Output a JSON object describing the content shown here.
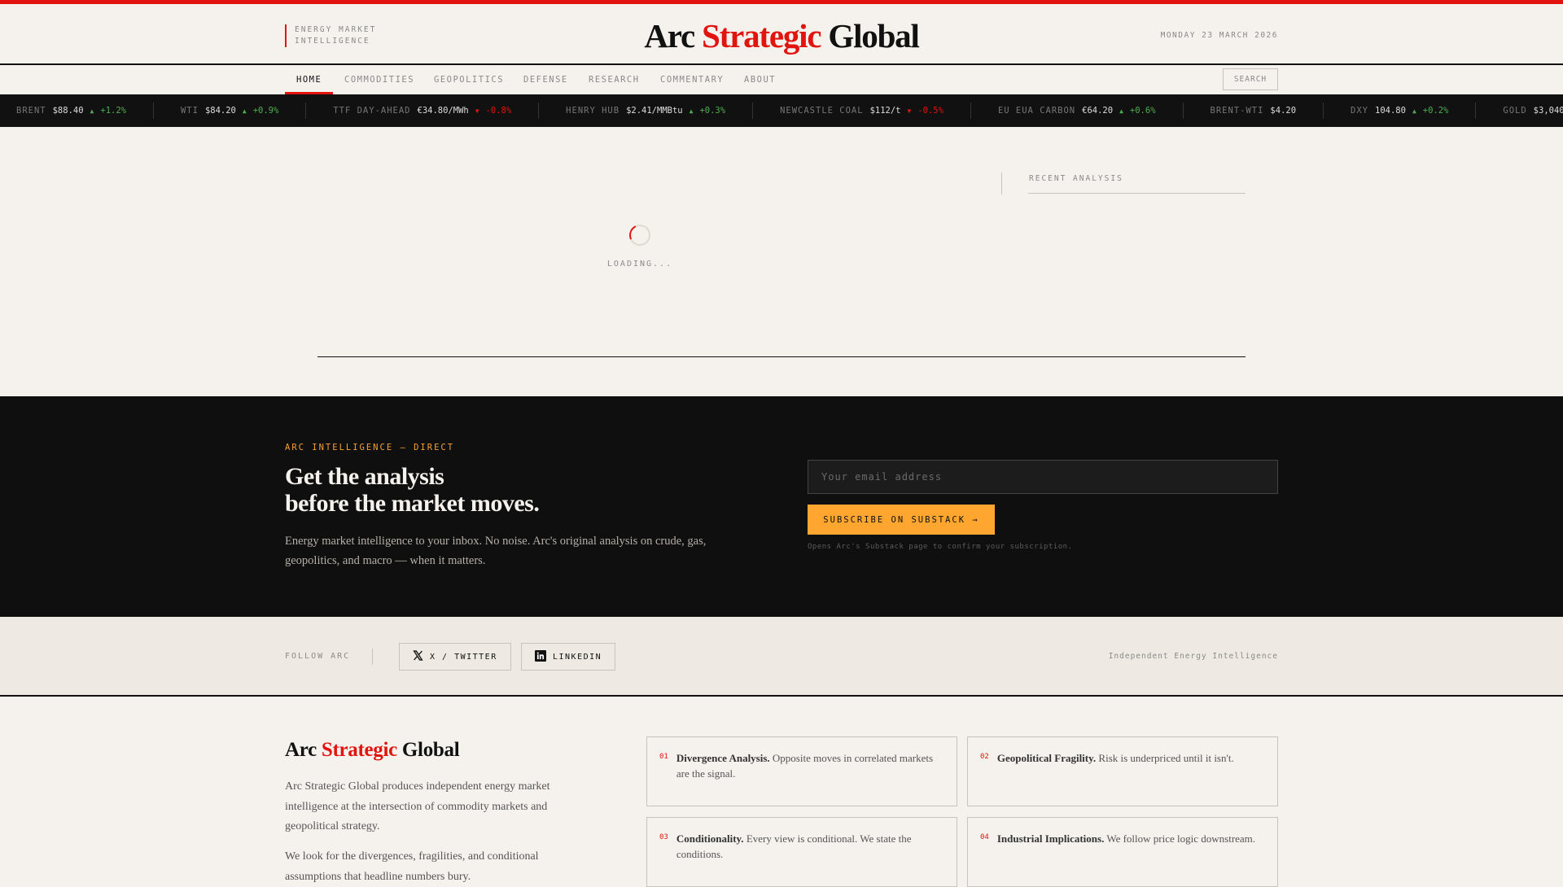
{
  "header": {
    "tagline_line1": "ENERGY MARKET",
    "tagline_line2": "INTELLIGENCE",
    "logo": {
      "part1": "Arc ",
      "part2": "Strategic",
      "part3": " Global"
    },
    "date": "MONDAY 23 MARCH 2026"
  },
  "nav": {
    "items": [
      "HOME",
      "COMMODITIES",
      "GEOPOLITICS",
      "DEFENSE",
      "RESEARCH",
      "COMMENTARY",
      "ABOUT"
    ],
    "active": "HOME",
    "search": "SEARCH"
  },
  "ticker": [
    {
      "name": "BRENT",
      "value": "$88.40",
      "dir": "up",
      "arrow": "▲",
      "change": "+1.2%"
    },
    {
      "name": "WTI",
      "value": "$84.20",
      "dir": "up",
      "arrow": "▲",
      "change": "+0.9%"
    },
    {
      "name": "TTF DAY-AHEAD",
      "value": "€34.80/MWh",
      "dir": "dn",
      "arrow": "▼",
      "change": "-0.8%"
    },
    {
      "name": "HENRY HUB",
      "value": "$2.41/MMBtu",
      "dir": "up",
      "arrow": "▲",
      "change": "+0.3%"
    },
    {
      "name": "NEWCASTLE COAL",
      "value": "$112/t",
      "dir": "dn",
      "arrow": "▼",
      "change": "-0.5%"
    },
    {
      "name": "EU EUA CARBON",
      "value": "€64.20",
      "dir": "up",
      "arrow": "▲",
      "change": "+0.6%"
    },
    {
      "name": "BRENT-WTI",
      "value": "$4.20",
      "dir": "",
      "arrow": "",
      "change": ""
    },
    {
      "name": "DXY",
      "value": "104.80",
      "dir": "up",
      "arrow": "▲",
      "change": "+0.2%"
    },
    {
      "name": "GOLD",
      "value": "$3,040",
      "dir": "up",
      "arrow": "▲",
      "change": "+"
    }
  ],
  "main": {
    "loading": "LOADING...",
    "recent_title": "RECENT ANALYSIS"
  },
  "subscribe": {
    "kicker": "ARC INTELLIGENCE — DIRECT",
    "headline1": "Get the analysis",
    "headline2": "before the market moves.",
    "body": "Energy market intelligence to your inbox. No noise. Arc's original analysis on crude, gas, geopolitics, and macro — when it matters.",
    "email_placeholder": "Your email address",
    "button": "SUBSCRIBE ON SUBSTACK →",
    "note": "Opens Arc's Substack page to confirm your subscription."
  },
  "follow": {
    "label": "FOLLOW ARC",
    "twitter": "X / TWITTER",
    "linkedin": "LINKEDIN",
    "tagline": "Independent Energy Intelligence"
  },
  "about": {
    "title": {
      "part1": "Arc ",
      "part2": "Strategic",
      "part3": " Global"
    },
    "p1": "Arc Strategic Global produces independent energy market intelligence at the intersection of commodity markets and geopolitical strategy.",
    "p2": "We look for the divergences, fragilities, and conditional assumptions that headline numbers bury.",
    "principles": [
      {
        "num": "01",
        "title": "Divergence Analysis.",
        "text": " Opposite moves in correlated markets are the signal."
      },
      {
        "num": "02",
        "title": "Geopolitical Fragility.",
        "text": " Risk is underpriced until it isn't."
      },
      {
        "num": "03",
        "title": "Conditionality.",
        "text": " Every view is conditional. We state the conditions."
      },
      {
        "num": "04",
        "title": "Industrial Implications.",
        "text": " We follow price logic downstream."
      }
    ]
  }
}
